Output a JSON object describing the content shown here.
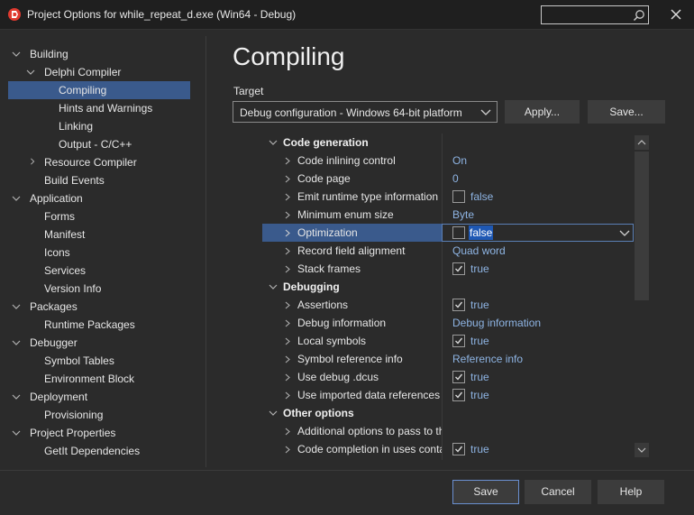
{
  "window": {
    "title": "Project Options for while_repeat_d.exe  (Win64 - Debug)",
    "search_placeholder": ""
  },
  "tree": [
    {
      "label": "Building",
      "expanded": true
    },
    {
      "label": "Delphi Compiler",
      "expanded": true
    },
    {
      "label": "Compiling",
      "selected": true
    },
    {
      "label": "Hints and Warnings"
    },
    {
      "label": "Linking"
    },
    {
      "label": "Output - C/C++"
    },
    {
      "label": "Resource Compiler",
      "expanded": false
    },
    {
      "label": "Build Events"
    },
    {
      "label": "Application",
      "expanded": true
    },
    {
      "label": "Forms"
    },
    {
      "label": "Manifest"
    },
    {
      "label": "Icons"
    },
    {
      "label": "Services"
    },
    {
      "label": "Version Info"
    },
    {
      "label": "Packages",
      "expanded": true
    },
    {
      "label": "Runtime Packages"
    },
    {
      "label": "Debugger",
      "expanded": true
    },
    {
      "label": "Symbol Tables"
    },
    {
      "label": "Environment Block"
    },
    {
      "label": "Deployment",
      "expanded": true
    },
    {
      "label": "Provisioning"
    },
    {
      "label": "Project Properties",
      "expanded": true
    },
    {
      "label": "GetIt Dependencies"
    }
  ],
  "page": {
    "title": "Compiling",
    "target_label": "Target",
    "target_value": "Debug configuration - Windows 64-bit platform",
    "apply_button": "Apply...",
    "save_target_button": "Save..."
  },
  "properties": [
    {
      "type": "category",
      "name": "Code generation"
    },
    {
      "type": "prop",
      "name": "Code inlining control",
      "value": "On"
    },
    {
      "type": "prop",
      "name": "Code page",
      "value": "0"
    },
    {
      "type": "prop",
      "name": "Emit runtime type information",
      "value": "false",
      "checkbox": true,
      "checked": false
    },
    {
      "type": "prop",
      "name": "Minimum enum size",
      "value": "Byte"
    },
    {
      "type": "prop",
      "name": "Optimization",
      "value": "false",
      "checkbox": true,
      "checked": false,
      "selected": true
    },
    {
      "type": "prop",
      "name": "Record field alignment",
      "value": "Quad word"
    },
    {
      "type": "prop",
      "name": "Stack frames",
      "value": "true",
      "checkbox": true,
      "checked": true
    },
    {
      "type": "category",
      "name": "Debugging"
    },
    {
      "type": "prop",
      "name": "Assertions",
      "value": "true",
      "checkbox": true,
      "checked": true
    },
    {
      "type": "prop",
      "name": "Debug information",
      "value": "Debug information"
    },
    {
      "type": "prop",
      "name": "Local symbols",
      "value": "true",
      "checkbox": true,
      "checked": true
    },
    {
      "type": "prop",
      "name": "Symbol reference info",
      "value": "Reference info"
    },
    {
      "type": "prop",
      "name": "Use debug .dcus",
      "value": "true",
      "checkbox": true,
      "checked": true
    },
    {
      "type": "prop",
      "name": "Use imported data references",
      "value": "true",
      "checkbox": true,
      "checked": true
    },
    {
      "type": "category",
      "name": "Other options"
    },
    {
      "type": "prop",
      "name": "Additional options to pass to th",
      "value": ""
    },
    {
      "type": "prop",
      "name": "Code completion in uses conta",
      "value": "true",
      "checkbox": true,
      "checked": true
    }
  ],
  "buttons": {
    "save": "Save",
    "cancel": "Cancel",
    "help": "Help"
  },
  "colors": {
    "background": "#2b2b2b",
    "selection": "#3a5a8c",
    "value_text": "#8eb4e3",
    "logo_red": "#e03a2f"
  }
}
